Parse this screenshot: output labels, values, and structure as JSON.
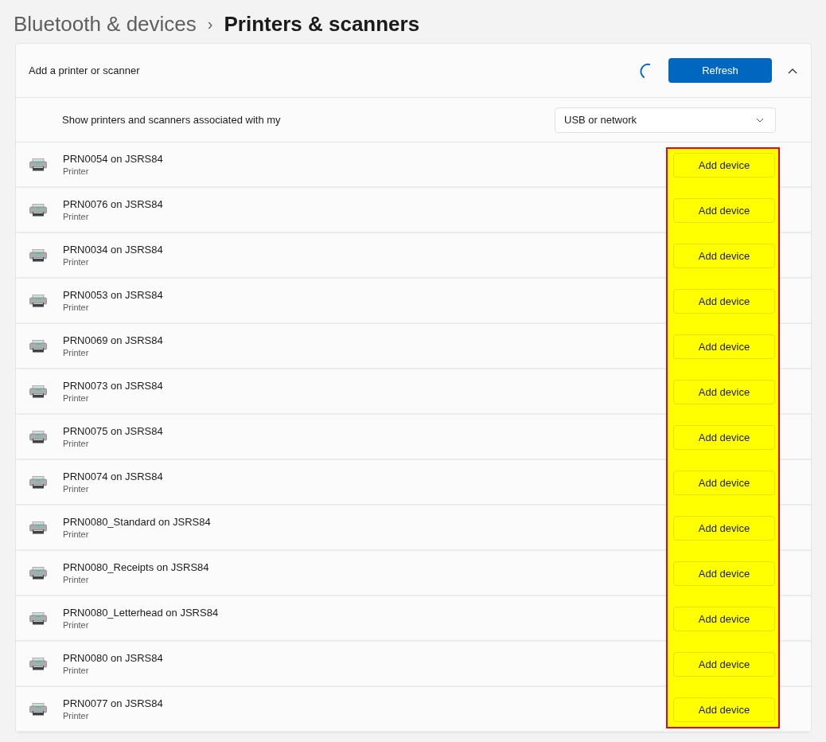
{
  "breadcrumb": {
    "parent": "Bluetooth & devices",
    "separator": "›",
    "current": "Printers & scanners"
  },
  "add_section": {
    "title": "Add a printer or scanner",
    "busy": true,
    "refresh_button": "Refresh",
    "expanded": true
  },
  "filter": {
    "label": "Show printers and scanners associated with my",
    "value": "USB or network"
  },
  "devices": [
    {
      "name": "PRN0054 on JSRS84",
      "type": "Printer",
      "action": "Add device"
    },
    {
      "name": "PRN0076 on JSRS84",
      "type": "Printer",
      "action": "Add device"
    },
    {
      "name": "PRN0034 on JSRS84",
      "type": "Printer",
      "action": "Add device"
    },
    {
      "name": "PRN0053 on JSRS84",
      "type": "Printer",
      "action": "Add device"
    },
    {
      "name": "PRN0069 on JSRS84",
      "type": "Printer",
      "action": "Add device"
    },
    {
      "name": "PRN0073 on JSRS84",
      "type": "Printer",
      "action": "Add device"
    },
    {
      "name": "PRN0075 on JSRS84",
      "type": "Printer",
      "action": "Add device"
    },
    {
      "name": "PRN0074 on JSRS84",
      "type": "Printer",
      "action": "Add device"
    },
    {
      "name": "PRN0080_Standard on JSRS84",
      "type": "Printer",
      "action": "Add device"
    },
    {
      "name": "PRN0080_Receipts on JSRS84",
      "type": "Printer",
      "action": "Add device"
    },
    {
      "name": "PRN0080_Letterhead on JSRS84",
      "type": "Printer",
      "action": "Add device"
    },
    {
      "name": "PRN0080 on JSRS84",
      "type": "Printer",
      "action": "Add device"
    },
    {
      "name": "PRN0077 on JSRS84",
      "type": "Printer",
      "action": "Add device"
    }
  ]
}
